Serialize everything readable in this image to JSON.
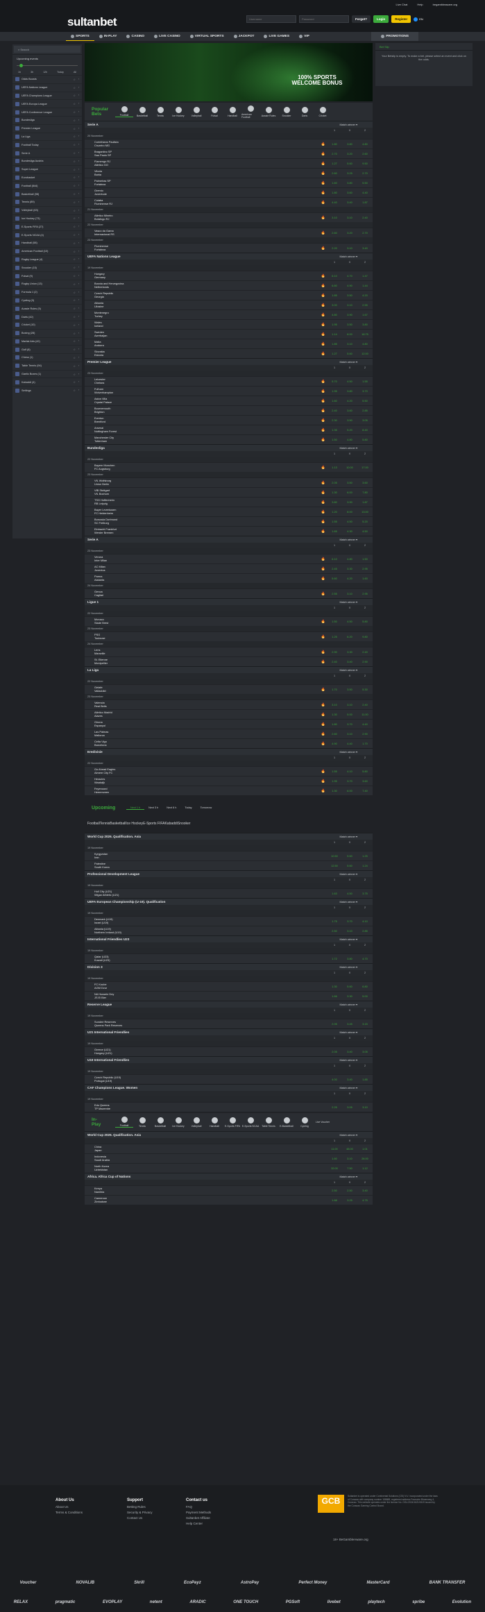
{
  "topbar": {
    "links": [
      "Live Chat",
      "Help",
      "begambleaware.org"
    ],
    "logo_a": "sultan",
    "logo_b": "bet",
    "username_ph": "Username",
    "password_ph": "Password",
    "forgot": "Forgot?",
    "login": "Login",
    "register": "Register",
    "lang": "EN"
  },
  "nav": {
    "items": [
      "SPORTS",
      "IN-PLAY",
      "CASINO",
      "LIVE CASINO",
      "VIRTUAL SPORTS",
      "JACKPOT",
      "LIVE GAMES",
      "VIP"
    ],
    "promo": "PROMOTIONS"
  },
  "sidebar": {
    "search": "Search",
    "upcoming": "Upcoming events",
    "ranges": [
      "1h",
      "3h",
      "12h",
      "Today",
      "All"
    ],
    "items": [
      "Odds Boosts",
      "UEFA Nations League",
      "UEFA Champions League",
      "UEFA Europa League",
      "UEFA Conference League",
      "Bundesliga",
      "Premier League",
      "La Liga",
      "Football Today",
      "Serie A",
      "Bundesliga Austria",
      "Super League",
      "Eurobasket",
      "Football (844)",
      "Basketball (98)",
      "Tennis (89)",
      "Volleyball (63)",
      "Ice Hockey (73)",
      "E-Sports FIFA (27)",
      "E-Sports NCAA (4)",
      "Handball (58)",
      "American Football (10)",
      "Rugby League (4)",
      "Snooker (15)",
      "Futsal (9)",
      "Rugby Union (13)",
      "Formula 1 (2)",
      "Cycling (3)",
      "Aussie Rules (9)",
      "Darts (42)",
      "Cricket (10)",
      "Boxing (28)",
      "Martial Arts (42)",
      "Golf (8)",
      "Chess (1)",
      "Table Tennis (94)",
      "Gaelic Boxes (1)",
      "Kabaddi (4)",
      "Settings"
    ]
  },
  "banner": {
    "line1": "100% SPORTS",
    "line2": "WELCOME BONUS"
  },
  "popular": {
    "title1": "Popular",
    "title2": "Bets",
    "sports": [
      "Football",
      "Basketball",
      "Tennis",
      "Ice Hockey",
      "Volleyball",
      "Futsal",
      "Handball",
      "American Football",
      "Aussie Rules",
      "Snooker",
      "Darts",
      "Cricket"
    ]
  },
  "market": "Match winner",
  "cols": [
    "1",
    "X",
    "2"
  ],
  "leagues": [
    {
      "name": "Serie A",
      "days": [
        {
          "date": "20 November",
          "rows": [
            [
              "Corinthians Paulista",
              "Cruzeiro MG",
              "1.80",
              "3.80",
              "4.80"
            ],
            [
              "Bragantino SP",
              "Sao Paulo SP",
              "2.70",
              "3.20",
              "2.60"
            ],
            [
              "Flamengo RJ",
              "Atletico GO",
              "1.27",
              "5.60",
              "9.50"
            ],
            [
              "Vitoria",
              "Bahia",
              "2.60",
              "3.25",
              "2.70"
            ],
            [
              "Palmeiras SP",
              "Fortaleza",
              "1.60",
              "3.80",
              "5.50"
            ],
            [
              "Gremio",
              "Juventude",
              "1.80",
              "3.60",
              "4.40"
            ],
            [
              "Cuiaba",
              "Fluminense RJ",
              "4.40",
              "3.40",
              "1.87"
            ]
          ]
        },
        {
          "date": "21 November",
          "rows": [
            [
              "Atletico Mineiro",
              "Botafogo RJ",
              "3.10",
              "3.10",
              "2.40"
            ]
          ]
        },
        {
          "date": "22 November",
          "rows": [
            [
              "Vasco da Gama",
              "Internacional RS",
              "2.60",
              "3.20",
              "2.70"
            ]
          ]
        },
        {
          "date": "23 November",
          "rows": [
            [
              "Fluminense",
              "Fortaleza",
              "2.20",
              "3.10",
              "3.40"
            ]
          ]
        }
      ]
    },
    {
      "name": "UEFA Nations League",
      "days": [
        {
          "date": "19 November",
          "rows": [
            [
              "Hungary",
              "Germany",
              "6.10",
              "4.70",
              "1.47"
            ],
            [
              "Bosnia and Herzegovina",
              "Netherlands",
              "6.80",
              "4.90",
              "1.44"
            ],
            [
              "Czech Republic",
              "Georgia",
              "1.85",
              "3.50",
              "4.20"
            ],
            [
              "Albania",
              "Ukraine",
              "3.00",
              "3.10",
              "2.55"
            ],
            [
              "Montenegro",
              "Turkey",
              "4.80",
              "3.90",
              "1.67"
            ],
            [
              "Wales",
              "Iceland",
              "1.95",
              "3.50",
              "3.80"
            ],
            [
              "Sweden",
              "Azerbaijan",
              "1.14",
              "8.00",
              "18.75"
            ],
            [
              "Malta",
              "Andorra",
              "1.85",
              "3.10",
              "4.80"
            ],
            [
              "Slovakia",
              "Estonia",
              "1.27",
              "5.60",
              "12.00"
            ]
          ]
        }
      ]
    },
    {
      "name": "Premier League",
      "days": [
        {
          "date": "23 November",
          "rows": [
            [
              "Leicester",
              "Chelsea",
              "5.70",
              "4.50",
              "1.55"
            ],
            [
              "Fulham",
              "Wolverhampton",
              "1.95",
              "3.80",
              "3.70"
            ],
            [
              "Aston Villa",
              "Crystal Palace",
              "1.60",
              "4.20",
              "5.50"
            ],
            [
              "Bournemouth",
              "Brighton",
              "2.40",
              "3.60",
              "2.85"
            ],
            [
              "Everton",
              "Brentford",
              "2.30",
              "3.50",
              "3.05"
            ],
            [
              "Arsenal",
              "Nottingham Forest",
              "1.35",
              "5.20",
              "8.40"
            ],
            [
              "Manchester City",
              "Tottenham",
              "1.50",
              "4.80",
              "5.80"
            ]
          ]
        }
      ]
    },
    {
      "name": "Bundesliga",
      "days": [
        {
          "date": "22 November",
          "rows": [
            [
              "Bayern Munchen",
              "FC Augsburg",
              "1.13",
              "10.00",
              "17.00"
            ]
          ]
        },
        {
          "date": "23 November",
          "rows": [
            [
              "VfL Wolfsburg",
              "Union Berlin",
              "2.05",
              "3.50",
              "3.60"
            ],
            [
              "VfB Stuttgart",
              "VfL Bochum",
              "1.30",
              "6.00",
              "7.80"
            ],
            [
              "TSG Hoffenheim",
              "RB Leipzig",
              "3.80",
              "3.90",
              "1.87"
            ],
            [
              "Bayer Leverkusen",
              "FC Heidenheim",
              "1.20",
              "8.00",
              "13.00"
            ],
            [
              "Borussia Dortmund",
              "SC Freiburg",
              "1.55",
              "4.50",
              "5.20"
            ],
            [
              "Eintracht Frankfurt",
              "Werder Bremen",
              "1.65",
              "4.30",
              "4.50"
            ]
          ]
        }
      ]
    },
    {
      "name": "Serie A",
      "days": [
        {
          "date": "23 November",
          "rows": [
            [
              "Verona",
              "Inter Milan",
              "6.10",
              "4.80",
              "1.50"
            ],
            [
              "AC Milan",
              "Juventus",
              "2.45",
              "3.30",
              "2.95"
            ],
            [
              "Parma",
              "Atalanta",
              "5.60",
              "4.20",
              "1.60"
            ]
          ]
        },
        {
          "date": "24 November",
          "rows": [
            [
              "Genoa",
              "Cagliari",
              "2.55",
              "3.10",
              "2.95"
            ]
          ]
        }
      ]
    },
    {
      "name": "Ligue 1",
      "days": [
        {
          "date": "22 November",
          "rows": [
            [
              "Monaco",
              "Stade Brest",
              "1.50",
              "4.50",
              "5.80"
            ]
          ]
        },
        {
          "date": "23 November",
          "rows": [
            [
              "PSG",
              "Toulouse",
              "1.25",
              "6.20",
              "9.80"
            ]
          ]
        },
        {
          "date": "24 November",
          "rows": [
            [
              "Lens",
              "Marseille",
              "2.90",
              "3.30",
              "2.40"
            ],
            [
              "St. Etienne",
              "Montpellier",
              "2.40",
              "3.40",
              "2.90"
            ]
          ]
        }
      ]
    },
    {
      "name": "La Liga",
      "days": [
        {
          "date": "22 November",
          "rows": [
            [
              "Getafe",
              "Valladolid",
              "1.70",
              "3.50",
              "5.30"
            ]
          ]
        },
        {
          "date": "23 November",
          "rows": [
            [
              "Valencia",
              "Real Betis",
              "3.10",
              "3.10",
              "2.40"
            ],
            [
              "Atletico Madrid",
              "Alaves",
              "1.30",
              "5.00",
              "11.00"
            ],
            [
              "Girona",
              "Espanyol",
              "1.80",
              "3.70",
              "4.40"
            ],
            [
              "Las Palmas",
              "Mallorca",
              "2.60",
              "3.10",
              "2.90"
            ],
            [
              "Celta Vigo",
              "Barcelona",
              "4.90",
              "4.40",
              "1.70"
            ]
          ]
        }
      ]
    },
    {
      "name": "Eredivisie",
      "days": [
        {
          "date": "22 November",
          "rows": [
            [
              "Go Ahead Eagles",
              "Almere City FC",
              "1.55",
              "4.10",
              "5.80"
            ],
            [
              "Heracles",
              "Waalwijk",
              "1.95",
              "3.70",
              "3.60"
            ],
            [
              "Feyenoord",
              "Heerenveen",
              "1.30",
              "6.00",
              "7.40"
            ]
          ]
        }
      ]
    }
  ],
  "upcoming": {
    "title": "Upcoming",
    "tabs": [
      "Next 1 h",
      "Next 3 h",
      "Next 6 h",
      "Today",
      "Tomorrow"
    ],
    "sports": [
      "Football",
      "Tennis",
      "Basketball",
      "Ice Hockey",
      "E-Sports FIFA",
      "Kabaddi",
      "Snooker"
    ],
    "leagues": [
      {
        "name": "World Cup 2026. Qualification. Asia",
        "date": "19 November",
        "rows": [
          [
            "Kyrgyzstan",
            "Iran",
            "10.50",
            "5.60",
            "1.25"
          ],
          [
            "Palestine",
            "South Korea",
            "12.50",
            "5.60",
            "1.24"
          ]
        ]
      },
      {
        "name": "Professional Development League",
        "date": "19 November",
        "rows": [
          [
            "Hull City (U21)",
            "Wigan Athletic (U21)",
            "1.63",
            "4.50",
            "3.75"
          ]
        ]
      },
      {
        "name": "UEFA European Championship (U-19). Qualification",
        "date": "19 November",
        "rows": [
          [
            "Denmark (U19)",
            "Israel (U19)",
            "1.75",
            "3.70",
            "4.10"
          ],
          [
            "Albania (U19)",
            "Northern Ireland (U19)",
            "2.50",
            "3.10",
            "2.85"
          ]
        ]
      },
      {
        "name": "International Friendlies U23",
        "date": "19 November",
        "rows": [
          [
            "Qatar (U23)",
            "Kuwait (U23)",
            "1.72",
            "3.80",
            "4.70"
          ]
        ]
      },
      {
        "name": "Division 3",
        "date": "19 November",
        "rows": [
          [
            "FC Koube",
            "AGM Dvur",
            "1.30",
            "5.60",
            "6.80"
          ],
          [
            "NA Hussein Dey",
            "JS El Bier",
            "1.66",
            "3.30",
            "5.00"
          ]
        ]
      },
      {
        "name": "Reserve League",
        "date": "19 November",
        "rows": [
          [
            "Sundee Reserves",
            "Queens Park Reserves",
            "2.05",
            "3.45",
            "3.15"
          ]
        ]
      },
      {
        "name": "U21 International Friendlies",
        "date": "19 November",
        "rows": [
          [
            "Greece (U21)",
            "Hungary (U21)",
            "2.05",
            "3.40",
            "3.05"
          ]
        ]
      },
      {
        "name": "U19 International Friendlies",
        "date": "19 November",
        "rows": [
          [
            "Czech Republic (U19)",
            "Portugal (U19)",
            "4.00",
            "3.40",
            "1.85"
          ]
        ]
      },
      {
        "name": "CAF Champions League. Women",
        "date": "19 November",
        "rows": [
          [
            "Edo Queens",
            "TP Mazembe",
            "2.25",
            "3.05",
            "3.10"
          ]
        ]
      }
    ]
  },
  "inplay": {
    "title1": "In-",
    "title2": "Play",
    "sports": [
      "Football",
      "Tennis",
      "Basketball",
      "Ice Hockey",
      "Volleyball",
      "Handball",
      "E-Sports FIFA",
      "E-Sports NCAA",
      "Table Tennis",
      "E-Basketball",
      "Cycling"
    ],
    "live": "Live Voucher",
    "leagues": [
      {
        "name": "World Cup 2026. Qualification. Asia",
        "rows": [
          [
            "China",
            "Japan",
            "11.00",
            "48.00",
            "1.01"
          ],
          [
            "Indonesia",
            "Saudi Arabia",
            "1.60",
            "3.10",
            "26.00"
          ],
          [
            "North Korea",
            "Uzbekistan",
            "32.00",
            "7.50",
            "1.12"
          ]
        ]
      },
      {
        "name": "Africa. Africa Cup of Nations",
        "rows": [
          [
            "Kenya",
            "Namibia",
            "2.50",
            "2.50",
            "3.40"
          ],
          [
            "Cameroon",
            "Zimbabwe",
            "1.88",
            "3.25",
            "4.75"
          ]
        ]
      }
    ]
  },
  "right": {
    "tab": "Bet Slip",
    "empty": "Your Betslip is empty. To make a bet, please select an event and click on the odds."
  },
  "footer": {
    "c1": {
      "h": "About Us",
      "items": [
        "About Us",
        "Terms & Conditions"
      ]
    },
    "c2": {
      "h": "Support",
      "items": [
        "Betting Rules",
        "Security & Privacy",
        "Contact Us"
      ]
    },
    "c3": {
      "h": "Contact us",
      "items": [
        "FAQ",
        "Payment Methods",
        "Sultanbet Affiliate",
        "Help Center"
      ]
    },
    "gcb": "GCB",
    "legal": "Sultanbet is operated under Continental Solutions (CSI) N.V. incorporated under the laws of Curacao with company number 158688, registered address Fransche Bloemweg 4, Curacao. This website operates under the license No. OGL/2024/1621/0619 issued by the Curacao Gaming Control Board.",
    "plus18": "18+ BeGambleAware.org",
    "providers1": [
      "Voucher",
      "NOVALIB",
      "Skrill",
      "EcoPayz",
      "AstroPay",
      "Perfect Money",
      "MasterCard",
      "BANK TRANSFER"
    ],
    "providers2": [
      "RELAX",
      "pragmatic",
      "EVOPLAY",
      "netent",
      "ARADIC",
      "ONE TOUCH",
      "PGSoft",
      "livebet",
      "playtech",
      "spribe",
      "Evolution"
    ]
  }
}
